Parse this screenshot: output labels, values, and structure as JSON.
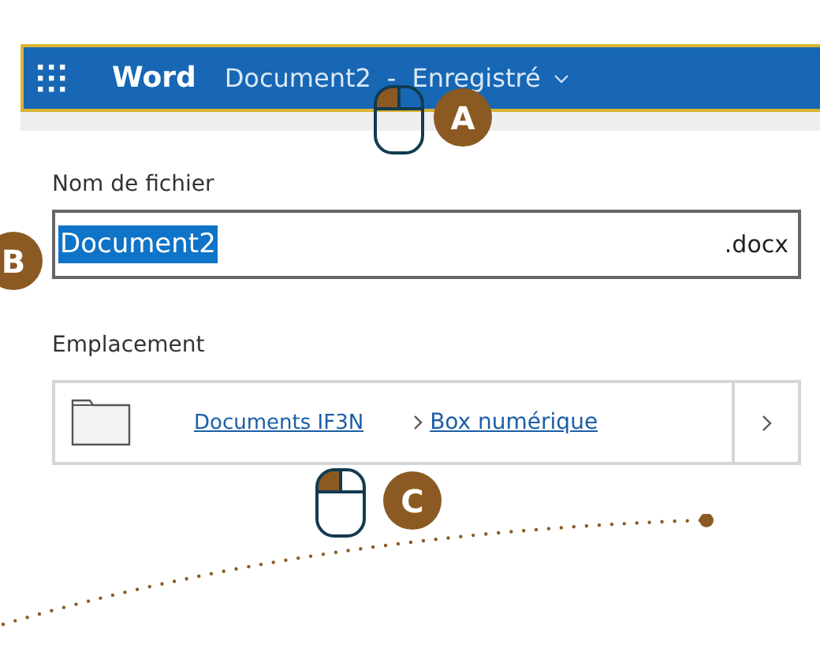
{
  "header": {
    "app_name": "Word",
    "document": "Document2",
    "separator": "-",
    "status": "Enregistré"
  },
  "filename": {
    "label": "Nom de fichier",
    "value": "Document2",
    "selected": true,
    "extension": ".docx"
  },
  "location": {
    "label": "Emplacement",
    "path": [
      {
        "text": "Documents IF3N"
      },
      {
        "text": "Box numérique"
      }
    ]
  },
  "callouts": [
    {
      "letter": "A",
      "mouse": true
    },
    {
      "letter": "B",
      "mouse": false
    },
    {
      "letter": "C",
      "mouse": true
    }
  ]
}
